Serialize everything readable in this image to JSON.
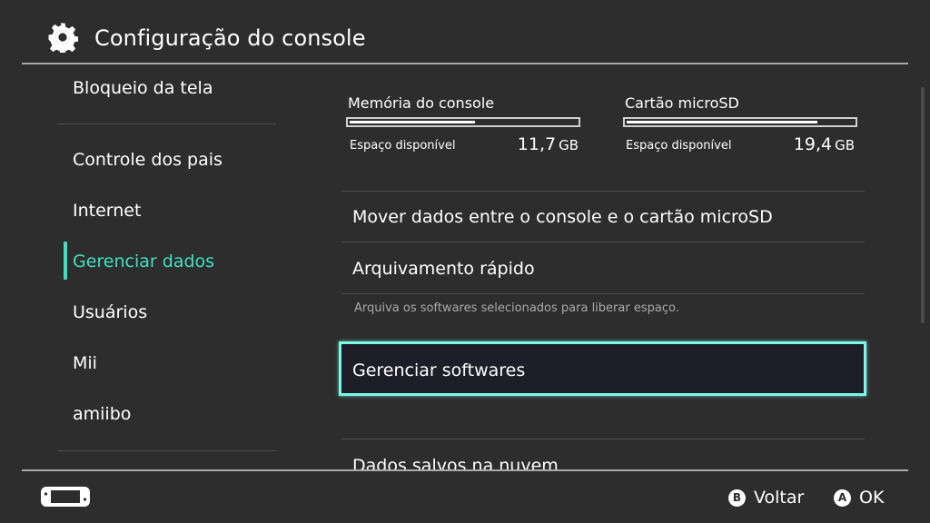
{
  "header": {
    "title": "Configuração do console",
    "icon": "gear-icon"
  },
  "sidebar": {
    "items": [
      {
        "label": "Bloqueio da tela"
      },
      {
        "label": "Controle dos pais"
      },
      {
        "label": "Internet"
      },
      {
        "label": "Gerenciar dados",
        "active": true
      },
      {
        "label": "Usuários"
      },
      {
        "label": "Mii"
      },
      {
        "label": "amiibo"
      }
    ],
    "accent_color": "#3fe0c2"
  },
  "storage": {
    "console": {
      "label": "Memória do console",
      "available_label": "Espaço disponível",
      "available_value": "11,7",
      "unit": "GB",
      "used_fraction": 0.55
    },
    "microsd": {
      "label": "Cartão microSD",
      "available_label": "Espaço disponível",
      "available_value": "19,4",
      "unit": "GB",
      "used_fraction": 0.84
    }
  },
  "main": {
    "rows": [
      {
        "label": "Mover dados entre o console e o cartão microSD"
      },
      {
        "label": "Arquivamento rápido",
        "description": "Arquiva os softwares selecionados para liberar espaço."
      },
      {
        "label": "Gerenciar softwares",
        "focused": true
      },
      {
        "label": "Dados salvos na nuvem"
      }
    ],
    "focus_color": "#7cf6e8"
  },
  "footer": {
    "controller_icon": "handheld-console-icon",
    "back": {
      "glyph": "B",
      "label": "Voltar"
    },
    "ok": {
      "glyph": "A",
      "label": "OK"
    }
  }
}
